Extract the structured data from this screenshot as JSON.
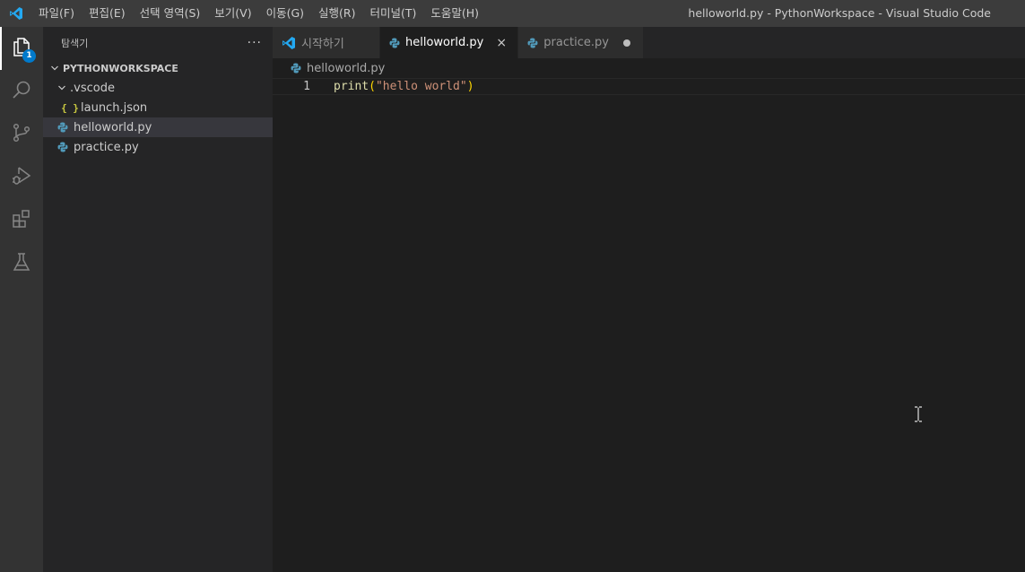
{
  "titlebar": {
    "menu": [
      "파일(F)",
      "편집(E)",
      "선택 영역(S)",
      "보기(V)",
      "이동(G)",
      "실행(R)",
      "터미널(T)",
      "도움말(H)"
    ],
    "window_title": "helloworld.py - PythonWorkspace - Visual Studio Code"
  },
  "activitybar": {
    "explorer_badge": "1",
    "icons": [
      "files-icon",
      "search-icon",
      "source-control-icon",
      "run-debug-icon",
      "extensions-icon",
      "testing-flask-icon"
    ]
  },
  "sidebar": {
    "title": "탐색기",
    "more": "···",
    "workspace": "PYTHONWORKSPACE",
    "tree": [
      {
        "label": ".vscode",
        "type": "folder"
      },
      {
        "label": "launch.json",
        "type": "json"
      },
      {
        "label": "helloworld.py",
        "type": "python",
        "selected": true
      },
      {
        "label": "practice.py",
        "type": "python"
      }
    ]
  },
  "tabs": [
    {
      "label": "시작하기",
      "icon": "vscode-logo-icon"
    },
    {
      "label": "helloworld.py",
      "icon": "python-icon",
      "active": true,
      "close": "×"
    },
    {
      "label": "practice.py",
      "icon": "python-icon",
      "dirty": true
    }
  ],
  "breadcrumb": "helloworld.py",
  "editor": {
    "lines": [
      {
        "number": "1",
        "fn": "print",
        "open": "(",
        "str": "\"hello world\"",
        "close": ")"
      }
    ]
  },
  "colors": {
    "accent": "#007acc",
    "titlebar": "#3c3c3c",
    "activitybar": "#333333",
    "sidebar": "#252526",
    "editor": "#1e1e1e"
  }
}
